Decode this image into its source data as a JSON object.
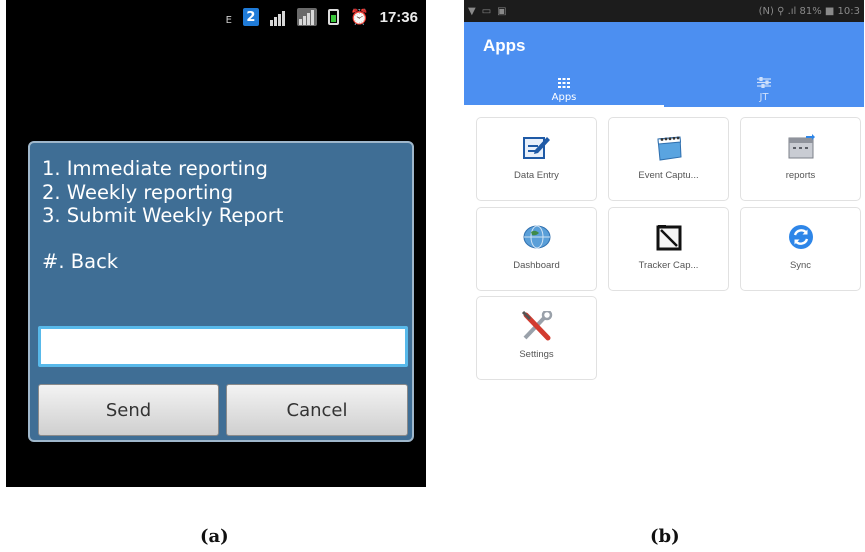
{
  "panel_a": {
    "status_bar": {
      "icons": [
        "network-type-icon",
        "sim-2-icon",
        "signal-bars-icon",
        "signal-bars-2-icon",
        "battery-icon",
        "alarm-clock-icon"
      ],
      "network_type": "E",
      "sim_badge": "2",
      "time": "17:36"
    },
    "ussd": {
      "menu_lines": [
        "1. Immediate reporting",
        "2. Weekly reporting",
        "3. Submit Weekly Report"
      ],
      "back_line": "#. Back",
      "input_value": "",
      "send_label": "Send",
      "cancel_label": "Cancel"
    },
    "caption": "(a)"
  },
  "panel_b": {
    "status_bar": {
      "left_icons": [
        "wifi-icon",
        "notification-icon",
        "gallery-icon"
      ],
      "right_text": "(N) ⚲ .ıl 81% ■ 10:3"
    },
    "app_bar": {
      "title": "Apps",
      "tabs": [
        {
          "label": "Apps",
          "icon": "grid-icon",
          "selected": true
        },
        {
          "label": "JT",
          "icon": "sliders-icon",
          "selected": false
        }
      ]
    },
    "tiles": [
      {
        "label": "Data Entry",
        "icon": "data-entry-icon"
      },
      {
        "label": "Event Captu...",
        "icon": "calendar-icon"
      },
      {
        "label": "reports",
        "icon": "reports-icon"
      },
      {
        "label": "Dashboard",
        "icon": "globe-icon"
      },
      {
        "label": "Tracker Cap...",
        "icon": "tracker-notebook-icon"
      },
      {
        "label": "Sync",
        "icon": "sync-icon"
      },
      {
        "label": "Settings",
        "icon": "tools-icon"
      }
    ],
    "colors": {
      "app_bar": "#4c8ff1",
      "sync_icon": "#2e86e8",
      "dialog_blue": "#3f6e95"
    },
    "caption": "(b)"
  }
}
